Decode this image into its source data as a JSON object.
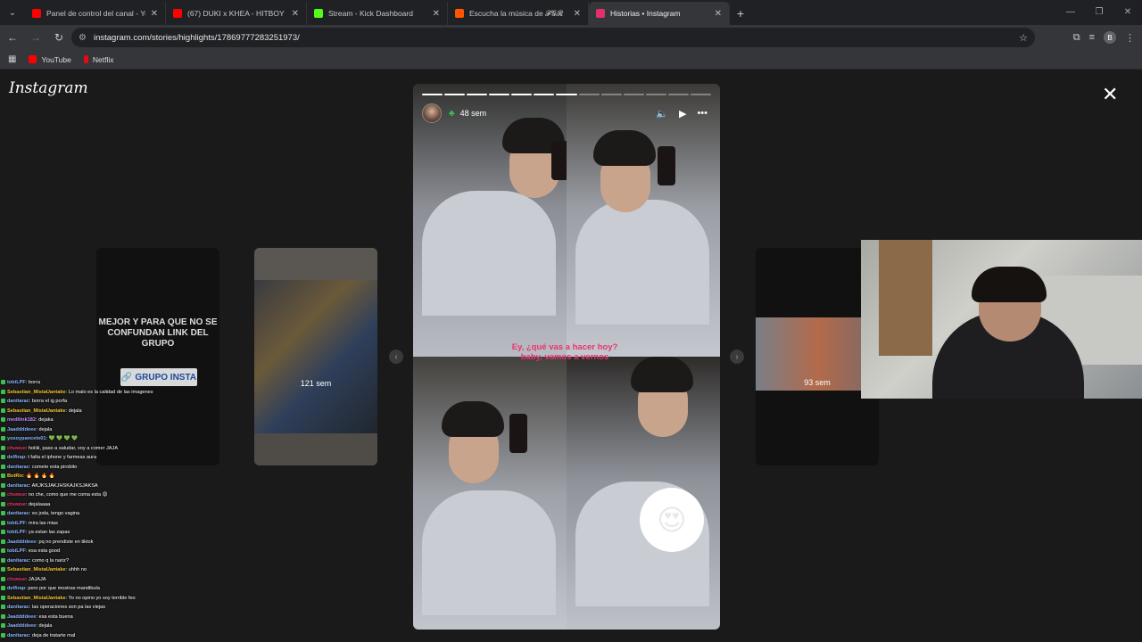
{
  "browser": {
    "tabs": [
      {
        "title": "Panel de control del canal - You",
        "color": "#ff0000",
        "active": false
      },
      {
        "title": "(67) DUKI x KHEA - HITBOY",
        "color": "#ff0000",
        "active": false
      },
      {
        "title": "Stream - Kick Dashboard",
        "color": "#53fc18",
        "active": false
      },
      {
        "title": "Escucha la música de 𝓕𝓖𝓡",
        "color": "#ff5500",
        "active": false
      },
      {
        "title": "Historias • Instagram",
        "color": "#e1306c",
        "active": true
      }
    ],
    "url": "instagram.com/stories/highlights/17869777283251973/",
    "profile_initial": "B",
    "bookmarks": [
      {
        "label": "YouTube",
        "color": "#ff0000"
      },
      {
        "label": "Netflix",
        "color": "#e50914"
      }
    ]
  },
  "instagram": {
    "logo": "Instagram",
    "story": {
      "time": "48 sem",
      "caption": "Ey, ¿qué vas a hacer hoy? baby, vamos a vernos",
      "sticker": "😍",
      "progress_total": 13,
      "progress_done": 7
    },
    "cards": [
      {
        "text": "MEJOR Y PARA QUE NO SE CONFUNDAN LINK DEL GRUPO",
        "button": "GRUPO INSTA"
      },
      {
        "time": "121 sem"
      },
      {
        "time": "93 sem"
      }
    ]
  },
  "chat": [
    {
      "user": "tobiLPF",
      "text": ": borra",
      "color": "#8ab4ff"
    },
    {
      "user": "Sebastian_MistaUantake",
      "text": ": Lo malo es la calidad de las imagenes",
      "color": "#f4c430"
    },
    {
      "user": "danitarac",
      "text": ": borra el ig porfa",
      "color": "#8ab4ff"
    },
    {
      "user": "Sebastian_MistaUantake",
      "text": ": dejala",
      "color": "#f4c430"
    },
    {
      "user": "medilink182",
      "text": ": dejaka",
      "color": "#c58cff"
    },
    {
      "user": "Jaaddddeee",
      "text": ": dejala",
      "color": "#8ab4ff"
    },
    {
      "user": "yosoypancete01",
      "text": ": 💚 💚 💚 💚",
      "color": "#8ab4ff"
    },
    {
      "user": "chuwue",
      "text": ": holiiii, paso a saludar, voy a comer JAJA",
      "color": "#e8356e"
    },
    {
      "user": "delfirap",
      "text": ": t falta el iphone y farmeas aura",
      "color": "#8ab4ff"
    },
    {
      "user": "danitarac",
      "text": ": comete esta pirobito",
      "color": "#8ab4ff"
    },
    {
      "user": "BotRix",
      "text": ": 🔥 🔥 🔥 🔥",
      "color": "#f4c430"
    },
    {
      "user": "danitarac",
      "text": ": AKJKSJAKJHSKAJKSJAKSA",
      "color": "#8ab4ff"
    },
    {
      "user": "chuwue",
      "text": ": no che, como que me coma esta 😡",
      "color": "#e8356e"
    },
    {
      "user": "chuwue",
      "text": ": dejalaaaa",
      "color": "#e8356e"
    },
    {
      "user": "danitarac",
      "text": ": es joda, tengo vagina",
      "color": "#8ab4ff"
    },
    {
      "user": "tobiLPF",
      "text": ": mira las mias",
      "color": "#8ab4ff"
    },
    {
      "user": "tobiLPF",
      "text": ": ya estan las zapas",
      "color": "#8ab4ff"
    },
    {
      "user": "Jaaddddeee",
      "text": ": pq no prendiste en tiktok",
      "color": "#8ab4ff"
    },
    {
      "user": "tobiLPF",
      "text": ": esa esta good",
      "color": "#8ab4ff"
    },
    {
      "user": "danitarac",
      "text": ": como q la nariz?",
      "color": "#8ab4ff"
    },
    {
      "user": "Sebastian_MistaUantake",
      "text": ": uhhh no",
      "color": "#f4c430"
    },
    {
      "user": "chuwue",
      "text": ": JAJAJA",
      "color": "#e8356e"
    },
    {
      "user": "delfirap",
      "text": ": pero por que mostras mandibula",
      "color": "#8ab4ff"
    },
    {
      "user": "Sebastian_MistaUantake",
      "text": ": Yo no opino yo soy terrible feo",
      "color": "#f4c430"
    },
    {
      "user": "danitarac",
      "text": ": las operaciones son pa las viejas",
      "color": "#8ab4ff"
    },
    {
      "user": "Jaaddddeee",
      "text": ": esa esta buena",
      "color": "#8ab4ff"
    },
    {
      "user": "Jaaddddeee",
      "text": ": dejala",
      "color": "#8ab4ff"
    },
    {
      "user": "danitarac",
      "text": ": deja de tratarte mal",
      "color": "#8ab4ff"
    }
  ]
}
